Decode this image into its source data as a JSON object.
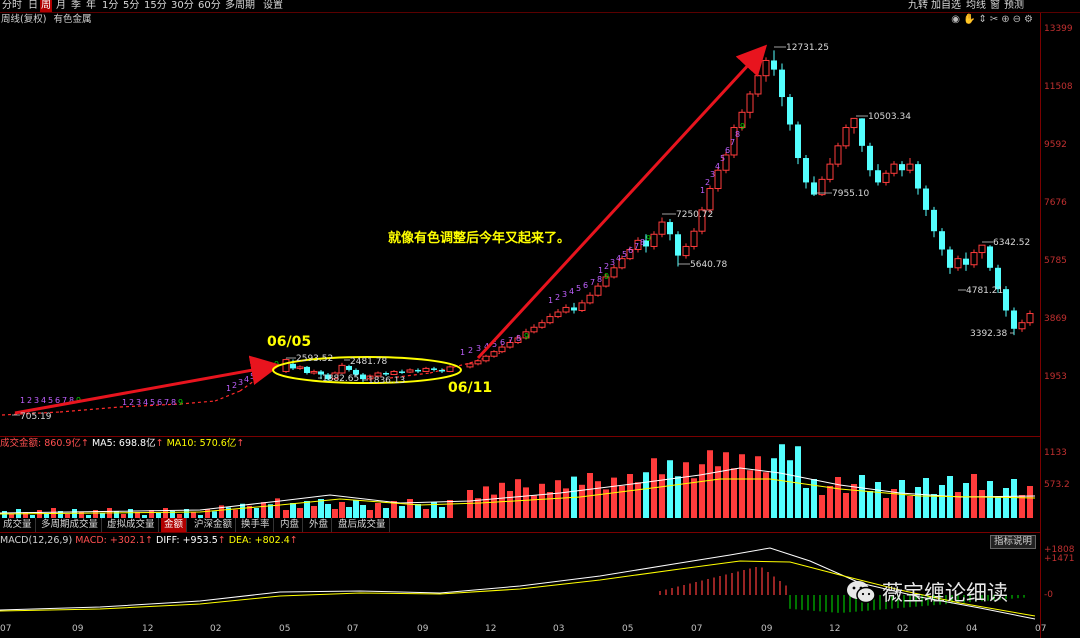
{
  "toolbar": {
    "periods": [
      "分时",
      "日",
      "周",
      "月",
      "季",
      "年",
      "1分",
      "5分",
      "15分",
      "30分",
      "60分",
      "多周期",
      "设置"
    ],
    "active_period": "周",
    "right_items": [
      "九转",
      "加自选",
      "均线",
      "窗",
      "预测"
    ]
  },
  "sub_header": {
    "adjust": "周线(复权)",
    "name": "有色金属"
  },
  "annotations": {
    "main_text": "就像有色调整后今年又起来了。",
    "label_0605": "06/05",
    "label_0611": "06/11"
  },
  "price_labels": {
    "low_start": "705.19",
    "peak1": "2593.52",
    "mid1": "2481.78",
    "low1": "1882.65",
    "low2": "1836.13",
    "hi2": "7250.72",
    "lo2": "5640.78",
    "top": "12731.25",
    "hi3": "10503.34",
    "lo3": "7955.10",
    "hi4": "6342.52",
    "lo4": "4781.21",
    "low_end": "3392.38"
  },
  "volume": {
    "label": "成交金额:",
    "value": "860.9亿",
    "ma5_label": "MA5: 698.8亿",
    "ma10_label": "MA10: 570.6亿",
    "tabs": [
      "成交量",
      "多周期成交量",
      "虚拟成交量",
      "金额",
      "沪深金额",
      "换手率",
      "内盘",
      "外盘",
      "盘后成交量"
    ],
    "active_tab": "金额",
    "ticks": [
      "1133",
      "573.2"
    ]
  },
  "macd": {
    "title": "MACD(12,26,9)",
    "macd_label": "MACD: +302.1",
    "diff_label": "DIFF: +953.5",
    "dea_label": "DEA: +802.4",
    "help": "指标说明",
    "ticks": [
      "+1808",
      "+1471",
      "-0"
    ]
  },
  "watermark": "薇宝缠论细读",
  "colors": {
    "up": "#ff3c3c",
    "down": "#54ffff",
    "annotation": "#ffff00",
    "arrow": "#e8141e",
    "nine_turn_count": "#c060ff",
    "nine_turn_nine": "#00d000"
  },
  "chart_data": {
    "type": "candlestick",
    "period": "weekly",
    "yaxis_ticks": [
      13399,
      11508,
      9592,
      7676,
      5785,
      3869,
      1953
    ],
    "xaxis_ticks": [
      "07",
      "09",
      "12",
      "02",
      "05",
      "07",
      "09",
      "12",
      "03",
      "05",
      "07",
      "09",
      "12",
      "02",
      "04",
      "07"
    ],
    "marked_prices": [
      705.19,
      2593.52,
      2481.78,
      1882.65,
      1836.13,
      7250.72,
      5640.78,
      12731.25,
      10503.34,
      7955.1,
      6342.52,
      4781.21,
      3392.38
    ],
    "volume_ticks": [
      1133,
      573.2
    ],
    "macd_ticks": [
      1808,
      1471,
      0
    ]
  }
}
